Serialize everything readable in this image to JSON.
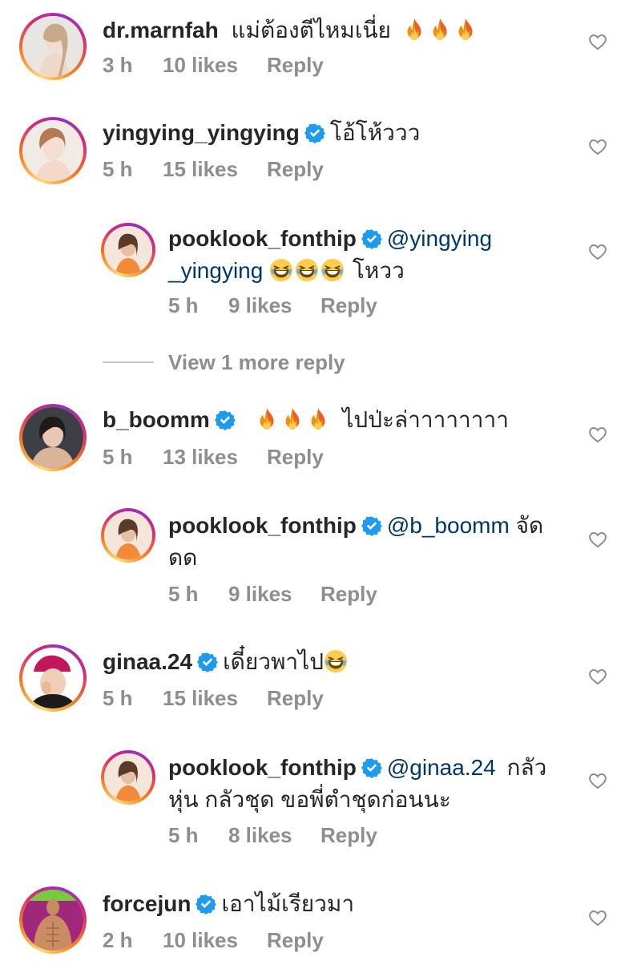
{
  "comments": [
    {
      "username": "dr.marnfah",
      "verified": false,
      "text": "แม่ต้องตีไหมเนี่ย",
      "emoji": [
        "fire",
        "fire",
        "fire"
      ],
      "time": "3 h",
      "likes": "10 likes",
      "reply": "Reply"
    },
    {
      "username": "yingying_yingying",
      "verified": true,
      "text": "โอ้โห้ววว",
      "emoji": [],
      "time": "5 h",
      "likes": "15 likes",
      "reply": "Reply"
    },
    {
      "username": "pooklook_fonthip",
      "verified": true,
      "mention": "@yingying",
      "mention2": "_yingying",
      "text": "โหวว",
      "emoji": [
        "laugh",
        "laugh",
        "laugh"
      ],
      "time": "5 h",
      "likes": "9 likes",
      "reply": "Reply"
    },
    {
      "username": "b_boomm",
      "verified": true,
      "text": "ไปป่ะล่าาาาาาาา",
      "emoji": [
        "fire",
        "fire",
        "fire"
      ],
      "time": "5 h",
      "likes": "13 likes",
      "reply": "Reply"
    },
    {
      "username": "pooklook_fonthip",
      "verified": true,
      "mention": "@b_boomm",
      "text": "จัด",
      "text2": "ดด",
      "time": "5 h",
      "likes": "9 likes",
      "reply": "Reply"
    },
    {
      "username": "ginaa.24",
      "verified": true,
      "text": "เดี๋ยวพาไป",
      "emoji": [
        "laugh"
      ],
      "time": "5 h",
      "likes": "15 likes",
      "reply": "Reply"
    },
    {
      "username": "pooklook_fonthip",
      "verified": true,
      "mention": "@ginaa.24",
      "text": "กลัว",
      "text2": "หุ่น กลัวชุด ขอพี่ตำชุดก่อนนะ",
      "time": "5 h",
      "likes": "8 likes",
      "reply": "Reply"
    },
    {
      "username": "forcejun",
      "verified": true,
      "text": "เอาไม้เรียวมา",
      "emoji": [],
      "time": "2 h",
      "likes": "10 likes",
      "reply": "Reply"
    }
  ],
  "view_more": "View 1 more reply",
  "colors": {
    "text": "#262626",
    "muted": "#8e8e8e",
    "mention": "#00376b",
    "verified": "#0095f6"
  }
}
